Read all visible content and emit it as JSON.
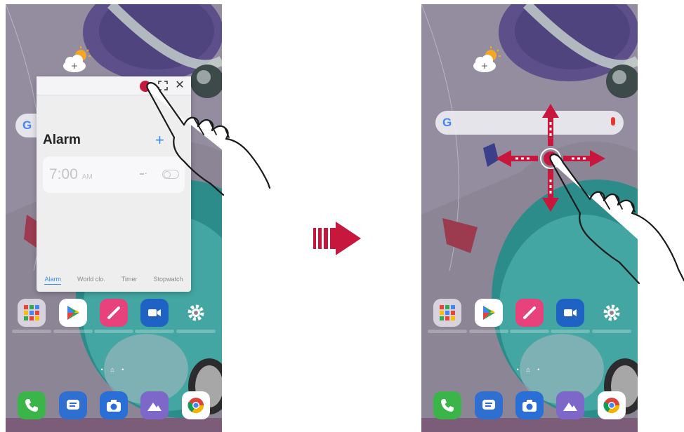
{
  "left_screen": {
    "popup": {
      "title": "Alarm",
      "add_symbol": "+",
      "titlebar_buttons": [
        "minimize-icon",
        "maximize-icon",
        "close-icon"
      ],
      "close_symbol": "✕",
      "alarm_time": "7:00",
      "alarm_ampm": "AM",
      "tabs": [
        "Alarm",
        "World clo.",
        "Timer",
        "Stopwatch"
      ],
      "active_tab": "Alarm"
    },
    "search_logo": "G"
  },
  "right_screen": {
    "search_logo": "G"
  },
  "home_apps": [
    "apps-folder-icon",
    "play-store-icon",
    "pencil-icon",
    "video-icon",
    "settings-icon"
  ],
  "dock_apps": [
    "phone-icon",
    "messages-icon",
    "camera-icon",
    "gallery-icon",
    "chrome-icon"
  ],
  "page_indicator": "• ⌂ •",
  "colors": {
    "accent_red": "#c8173d",
    "accent_blue": "#3a8ee6",
    "phone_green": "#3bb54a",
    "messages_blue": "#2f6fd0",
    "pencil_pink": "#e8427c",
    "video_blue": "#1e63c4"
  }
}
